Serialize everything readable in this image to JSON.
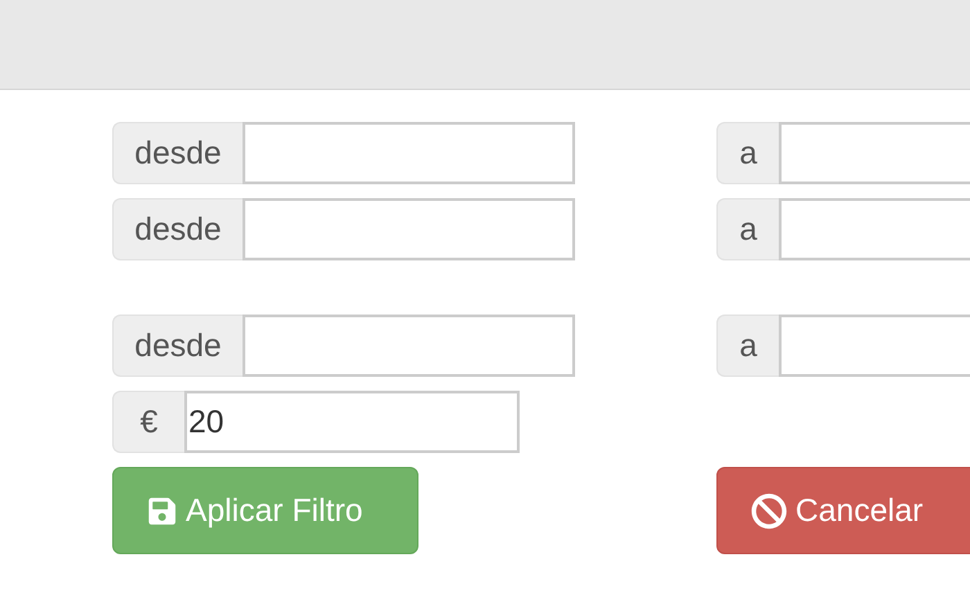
{
  "range_groups": [
    {
      "ranges": [
        {
          "from": {
            "addon": "desde"
          },
          "to": {
            "addon": "a"
          }
        },
        {
          "from": {
            "addon": "desde"
          },
          "to": {
            "addon": "a"
          }
        }
      ]
    },
    {
      "ranges": [
        {
          "from": {
            "addon": "desde"
          },
          "to": {
            "addon": "a"
          }
        }
      ]
    }
  ],
  "amount": {
    "addon": "€",
    "value": "20"
  },
  "buttons": [
    {
      "kind": "apply",
      "label": "Aplicar Filtro"
    },
    {
      "kind": "cancel",
      "label": "Cancelar"
    }
  ]
}
